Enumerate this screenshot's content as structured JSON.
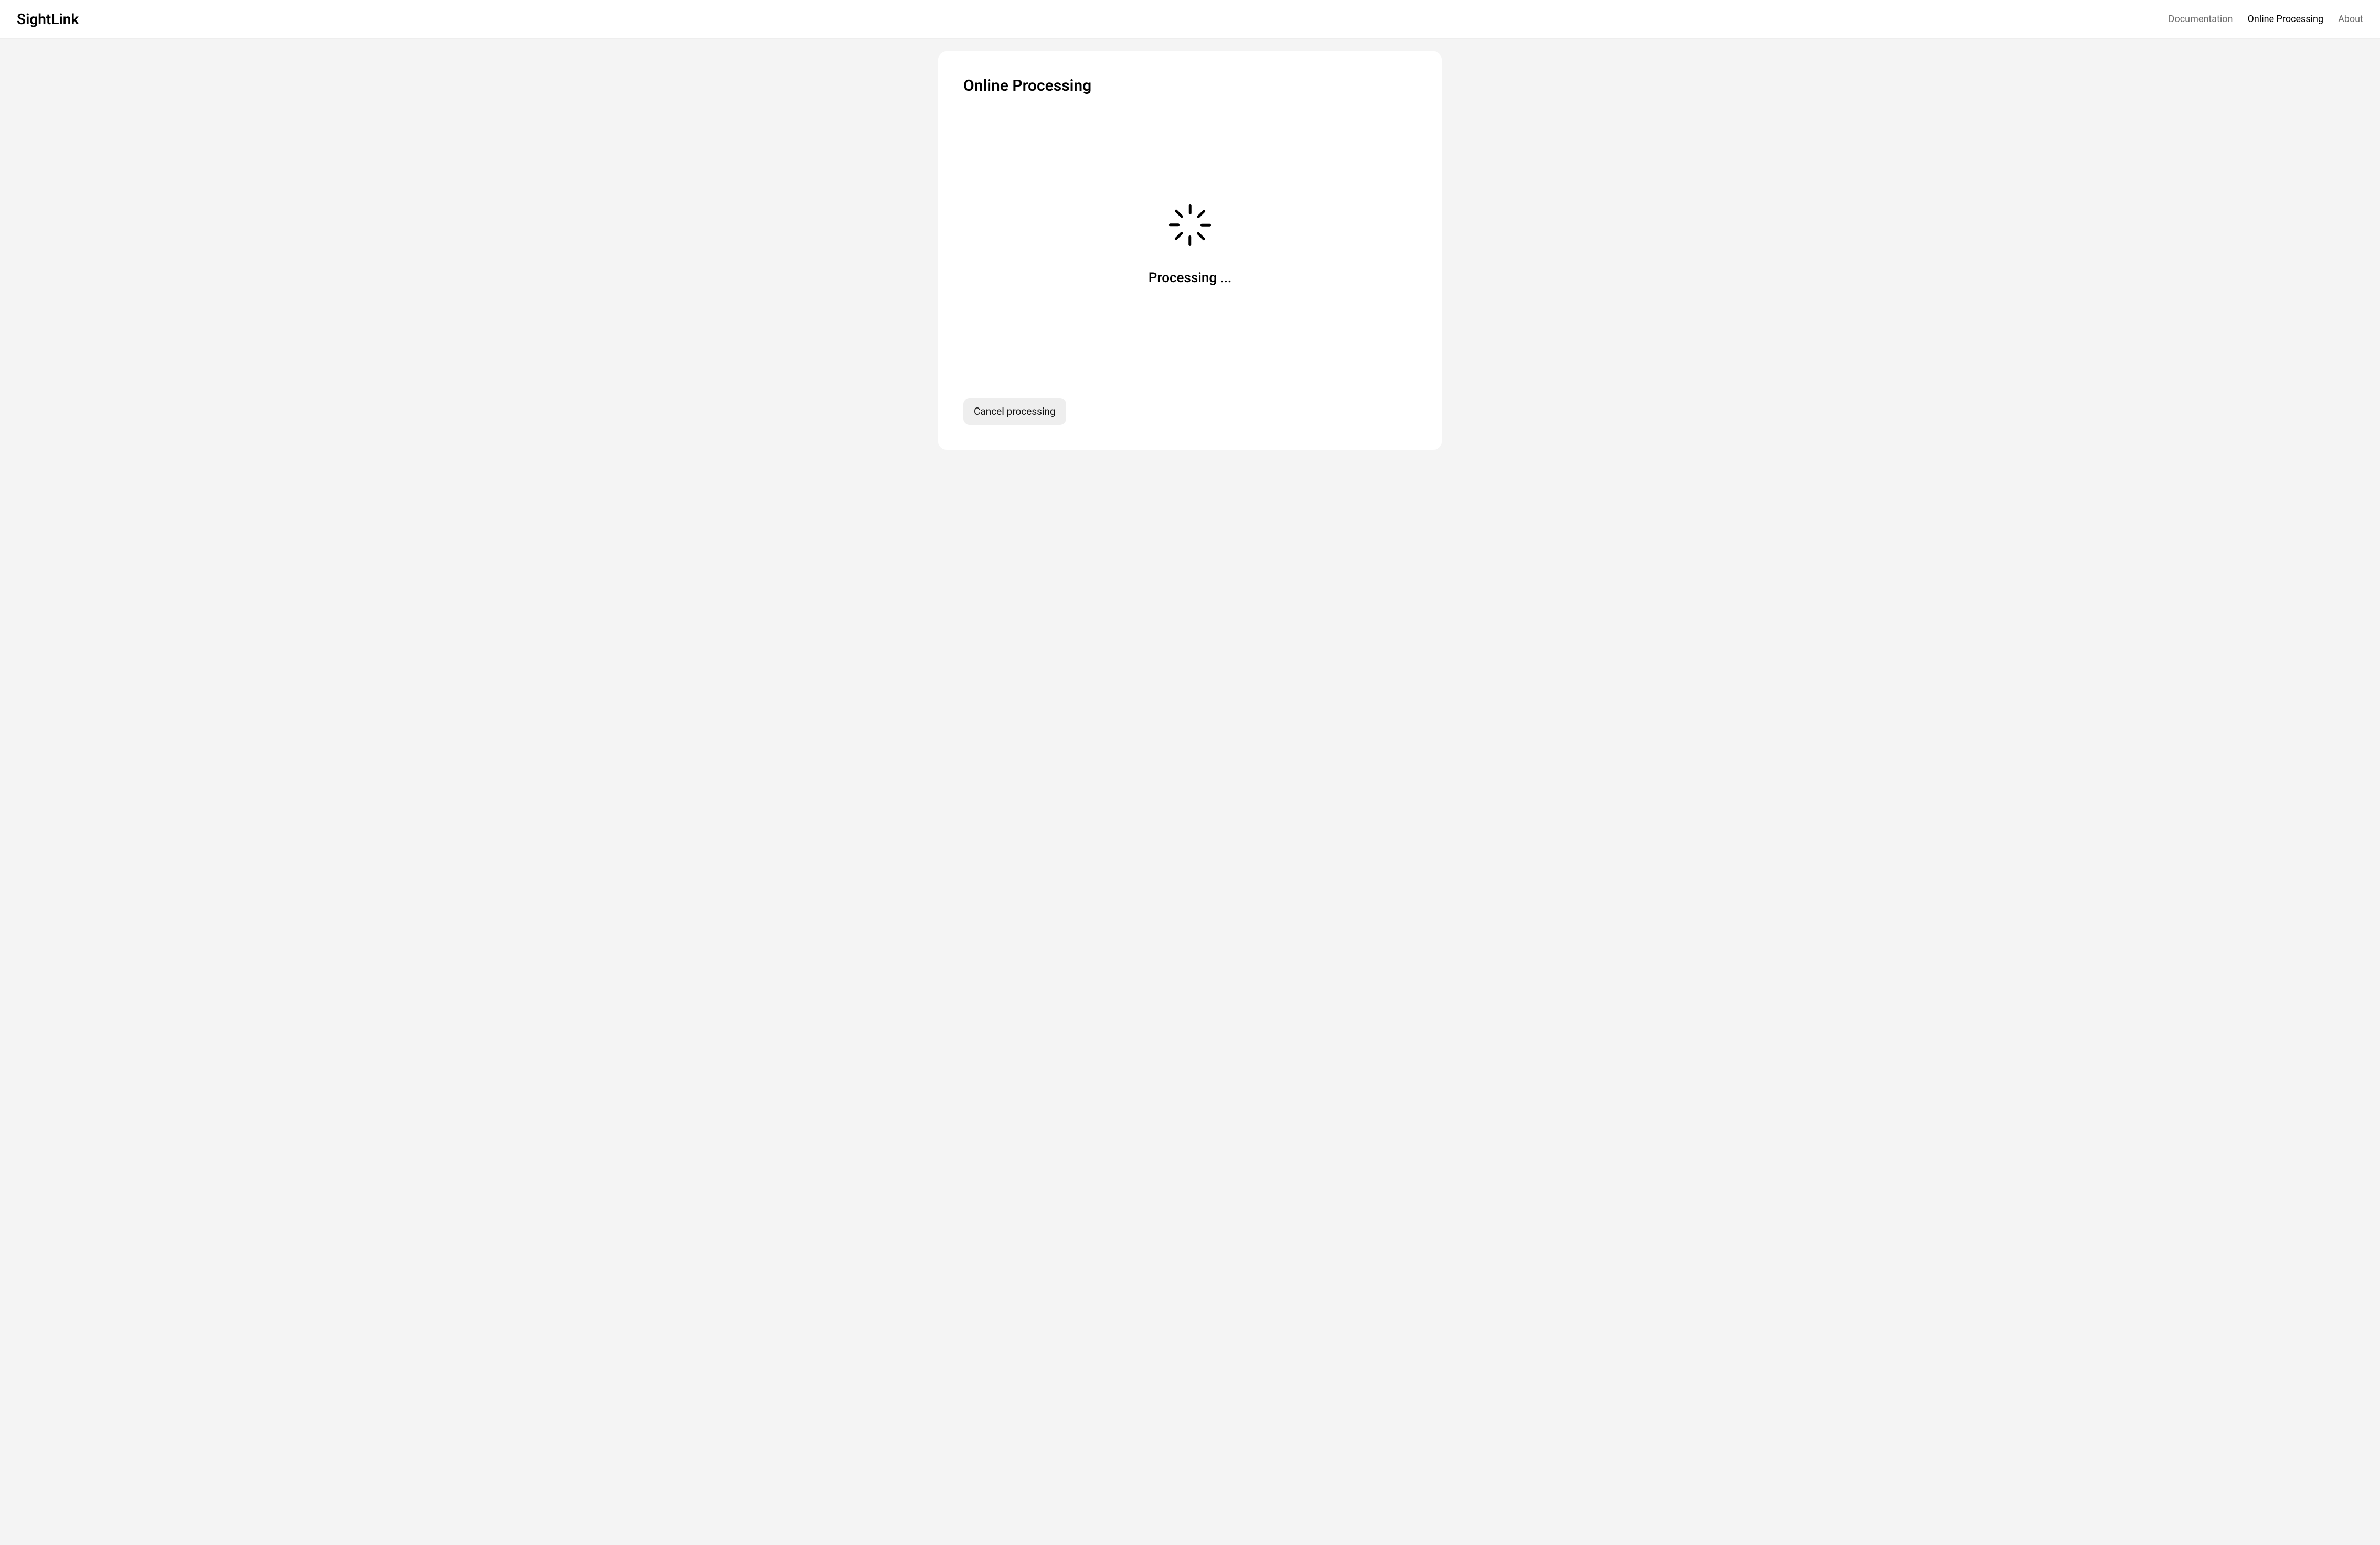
{
  "header": {
    "brand": "SightLink",
    "nav": [
      {
        "label": "Documentation",
        "active": false
      },
      {
        "label": "Online Processing",
        "active": true
      },
      {
        "label": "About",
        "active": false
      }
    ]
  },
  "main": {
    "card_title": "Online Processing",
    "status_text": "Processing ...",
    "cancel_label": "Cancel processing"
  }
}
